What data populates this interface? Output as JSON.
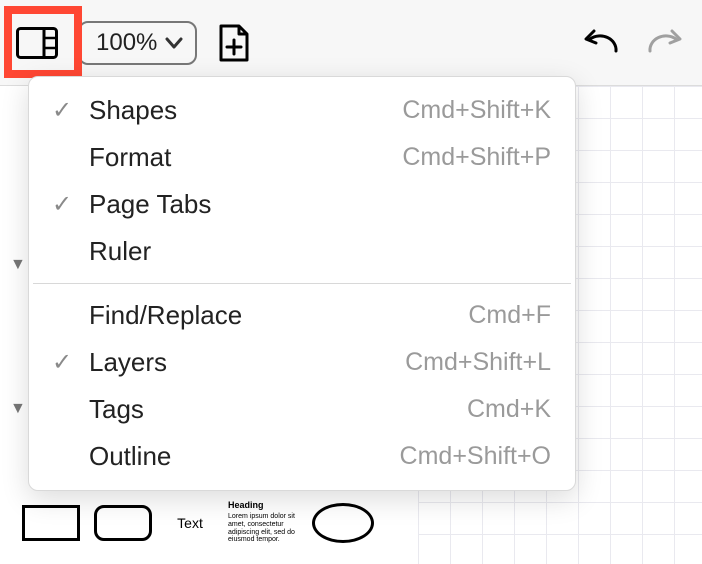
{
  "toolbar": {
    "zoom_level": "100%"
  },
  "menu": {
    "items": [
      {
        "label": "Shapes",
        "shortcut": "Cmd+Shift+K",
        "checked": true
      },
      {
        "label": "Format",
        "shortcut": "Cmd+Shift+P",
        "checked": false
      },
      {
        "label": "Page Tabs",
        "shortcut": "",
        "checked": true
      },
      {
        "label": "Ruler",
        "shortcut": "",
        "checked": false
      }
    ],
    "items2": [
      {
        "label": "Find/Replace",
        "shortcut": "Cmd+F",
        "checked": false
      },
      {
        "label": "Layers",
        "shortcut": "Cmd+Shift+L",
        "checked": true
      },
      {
        "label": "Tags",
        "shortcut": "Cmd+K",
        "checked": false
      },
      {
        "label": "Outline",
        "shortcut": "Cmd+Shift+O",
        "checked": false
      }
    ]
  },
  "shapes": {
    "text_label": "Text",
    "heading_title": "Heading",
    "heading_body": "Lorem ipsum dolor sit amet, consectetur adipiscing elit, sed do eiusmod tempor."
  }
}
